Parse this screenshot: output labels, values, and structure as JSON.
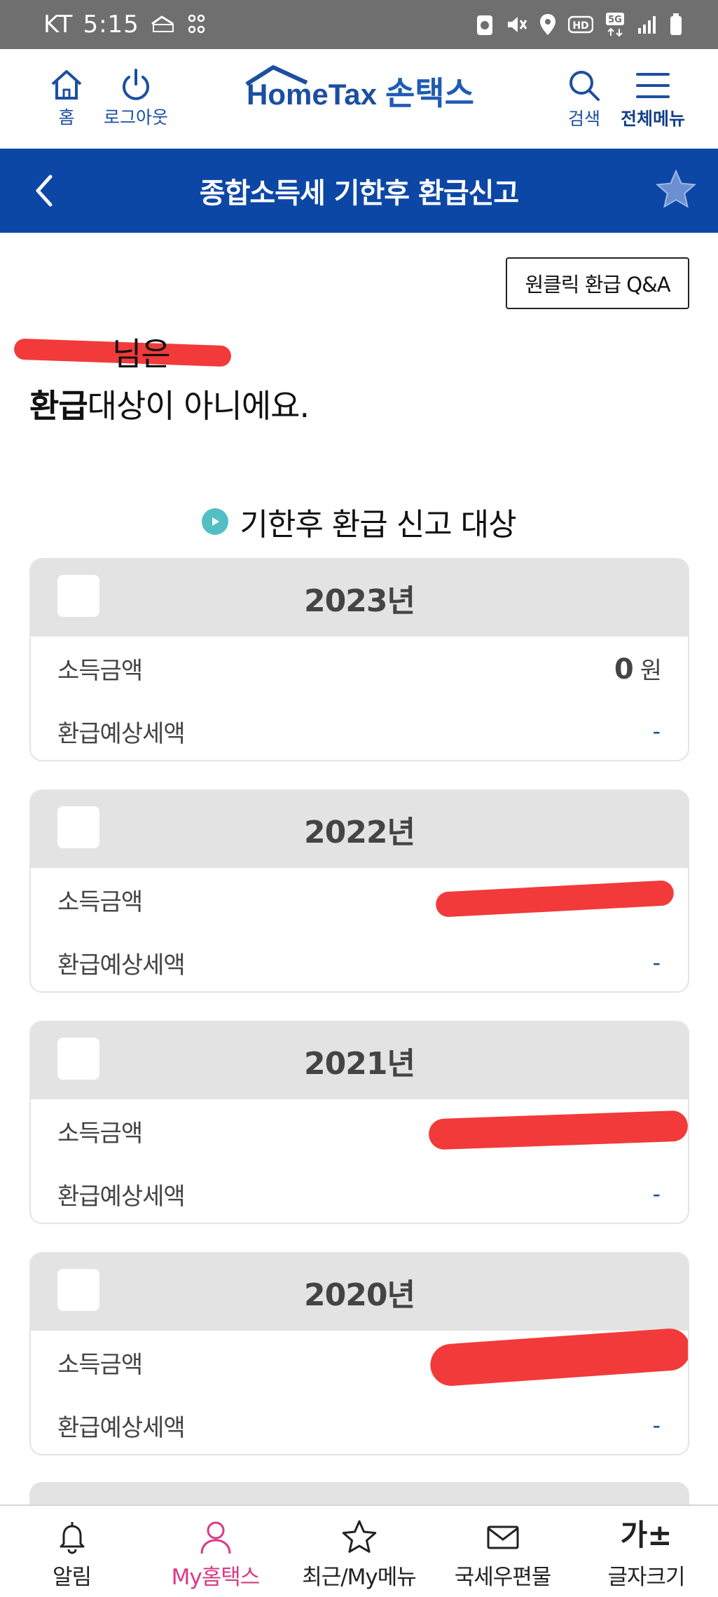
{
  "status_bar": {
    "carrier": "KT",
    "time": "5:15"
  },
  "header": {
    "home_label": "홈",
    "logout_label": "로그아웃",
    "logo_text": "HomeTax",
    "logo_korean": "손택스",
    "search_label": "검색",
    "menu_label": "전체메뉴"
  },
  "title_bar": {
    "title": "종합소득세 기한후 환급신고"
  },
  "qa_button": {
    "label": "원클릭 환급 Q&A"
  },
  "message": {
    "line1_suffix": "님은",
    "line2_strong": "환급",
    "line2_rest": "대상이 아니에요."
  },
  "section": {
    "title": "기한후 환급 신고 대상"
  },
  "cards": [
    {
      "year": "2023년",
      "income_label": "소득금액",
      "income_value": "0",
      "income_unit": "원",
      "refund_label": "환급예상세액",
      "refund_value": "-"
    },
    {
      "year": "2022년",
      "income_label": "소득금액",
      "income_value": "",
      "income_unit": "",
      "refund_label": "환급예상세액",
      "refund_value": "-"
    },
    {
      "year": "2021년",
      "income_label": "소득금액",
      "income_value": "",
      "income_unit": "",
      "refund_label": "환급예상세액",
      "refund_value": "-"
    },
    {
      "year": "2020년",
      "income_label": "소득금액",
      "income_value": "",
      "income_unit": "",
      "refund_label": "환급예상세액",
      "refund_value": "-"
    }
  ],
  "bottom_nav": {
    "alarm": "알림",
    "my_hometax": "My홈택스",
    "recent_menu": "최근/My메뉴",
    "mailbox": "국세우편물",
    "font_size_glyph": "가±",
    "font_size": "글자크기"
  },
  "colors": {
    "brand_blue": "#0d47a6",
    "accent_pink": "#d93a86",
    "redaction": "#f23a3a"
  }
}
